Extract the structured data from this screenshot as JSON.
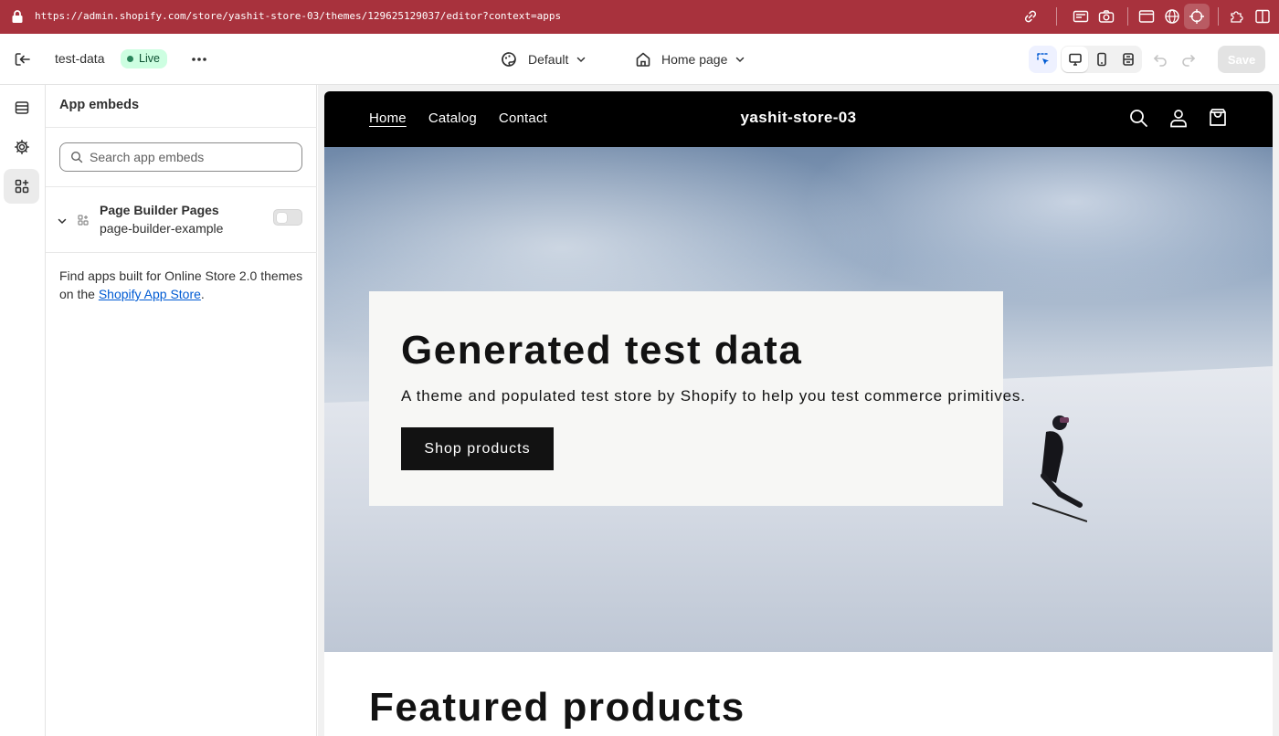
{
  "browser": {
    "url": "https://admin.shopify.com/store/yashit-store-03/themes/129625129037/editor?context=apps"
  },
  "topbar": {
    "theme_name": "test-data",
    "status_badge": "Live",
    "preset": "Default",
    "page": "Home page",
    "save_label": "Save"
  },
  "sidebar": {
    "title": "App embeds",
    "search_placeholder": "Search app embeds",
    "embeds": [
      {
        "name": "Page Builder Pages",
        "handle": "page-builder-example",
        "enabled": false
      }
    ],
    "find_text": "Find apps built for Online Store 2.0 themes on the ",
    "find_link": "Shopify App Store",
    "find_end": "."
  },
  "preview": {
    "nav": [
      "Home",
      "Catalog",
      "Contact"
    ],
    "store_name": "yashit-store-03",
    "hero_title": "Generated test data",
    "hero_text": "A theme and populated test store by Shopify to help you test commerce primitives.",
    "hero_button": "Shop products",
    "featured_title": "Featured products"
  },
  "colors": {
    "browser_bar": "#a8323d",
    "live_badge_bg": "#cdfee1",
    "link": "#005bd3",
    "store_header": "#000000"
  }
}
